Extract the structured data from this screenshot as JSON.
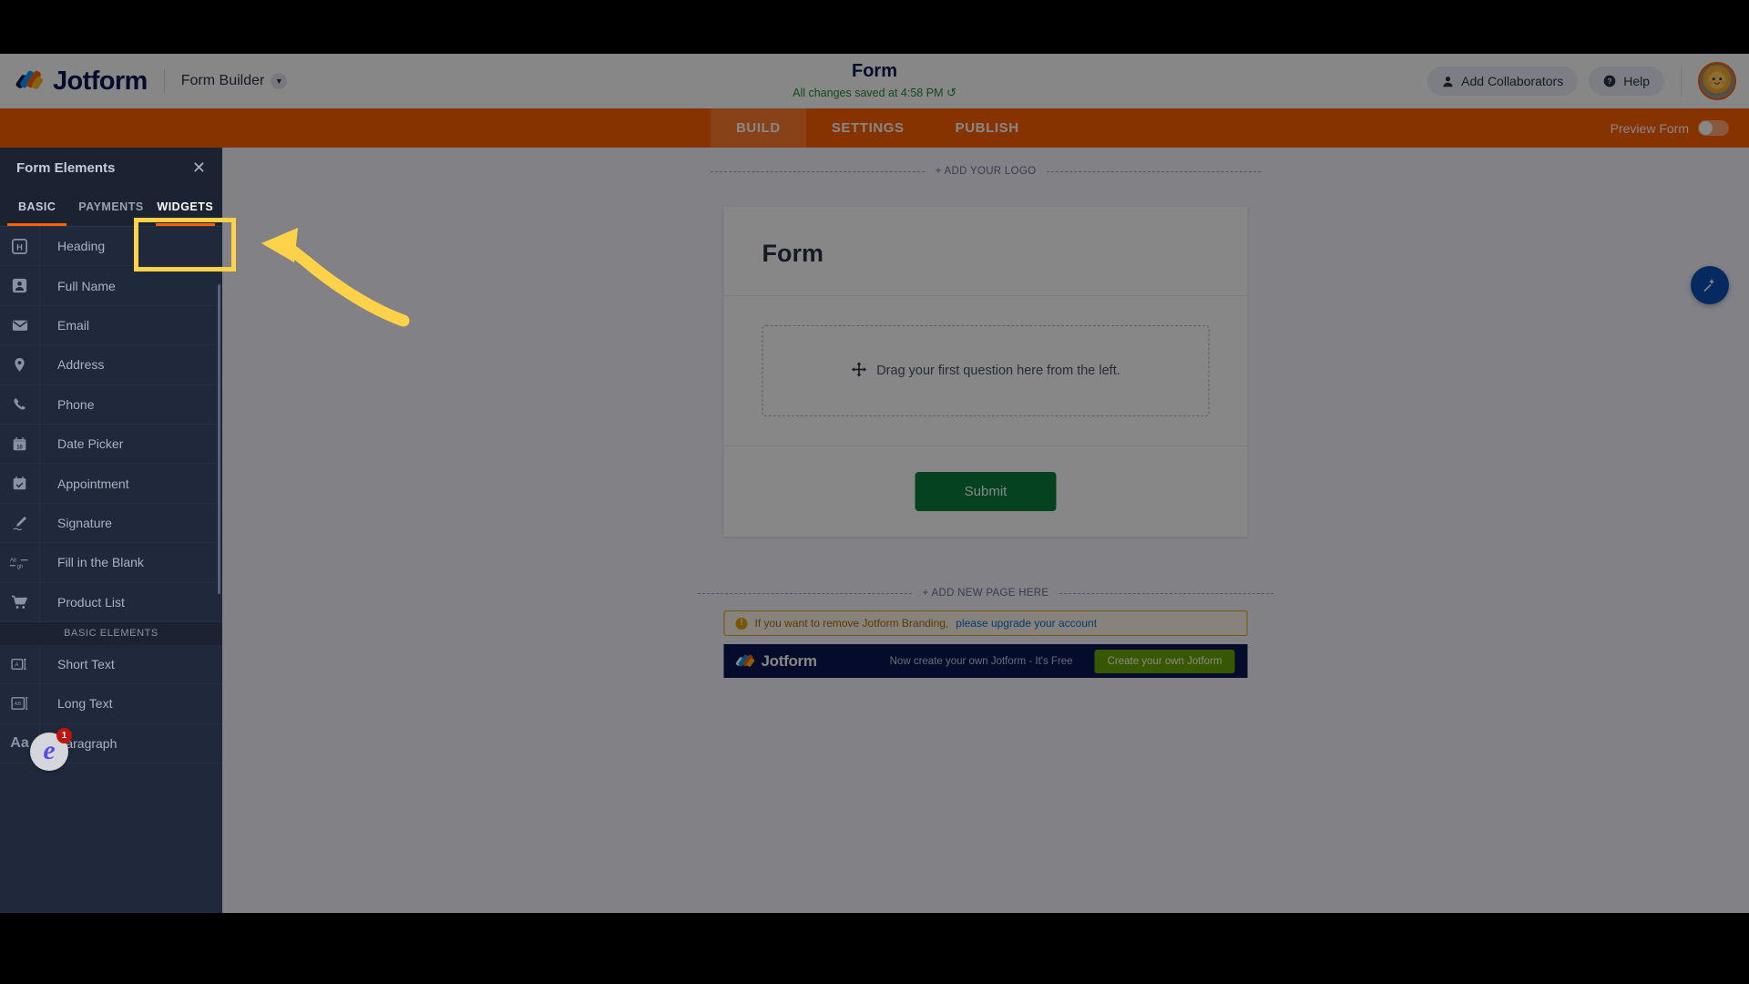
{
  "header": {
    "brand_name": "Jotform",
    "product_menu": "Form Builder",
    "form_title": "Form",
    "save_status": "All changes saved at 4:58 PM",
    "undo_icon": "↺",
    "add_collaborators": "Add Collaborators",
    "help": "Help",
    "collaborator_icon": "person-icon",
    "help_icon": "question-circle-icon",
    "avatar_icon": "user-avatar"
  },
  "navbar": {
    "tabs": [
      {
        "label": "BUILD",
        "active": true
      },
      {
        "label": "SETTINGS",
        "active": false
      },
      {
        "label": "PUBLISH",
        "active": false
      }
    ],
    "preview_label": "Preview Form",
    "preview_on": false
  },
  "sidebar": {
    "title": "Form Elements",
    "close_icon": "close-icon",
    "tabs": [
      {
        "label": "BASIC",
        "active": true
      },
      {
        "label": "PAYMENTS",
        "active": false
      },
      {
        "label": "WIDGETS",
        "active": false,
        "highlighted": true
      }
    ],
    "items": [
      {
        "label": "Heading",
        "icon": "heading-icon"
      },
      {
        "label": "Full Name",
        "icon": "person-card-icon"
      },
      {
        "label": "Email",
        "icon": "envelope-icon"
      },
      {
        "label": "Address",
        "icon": "location-pin-icon"
      },
      {
        "label": "Phone",
        "icon": "phone-icon"
      },
      {
        "label": "Date Picker",
        "icon": "calendar-10-icon"
      },
      {
        "label": "Appointment",
        "icon": "calendar-check-icon"
      },
      {
        "label": "Signature",
        "icon": "pen-signature-icon"
      },
      {
        "label": "Fill in the Blank",
        "icon": "ab-gh-icon"
      },
      {
        "label": "Product List",
        "icon": "shopping-cart-icon"
      }
    ],
    "section_label": "BASIC ELEMENTS",
    "basic_items": [
      {
        "label": "Short Text",
        "icon": "short-text-icon"
      },
      {
        "label": "Long Text",
        "icon": "long-text-icon"
      },
      {
        "label": "Paragraph",
        "icon": "aa-text-icon"
      }
    ]
  },
  "canvas": {
    "add_logo_label": "+ ADD YOUR LOGO",
    "form_heading": "Form",
    "dropzone_text": "Drag your first question here from the left.",
    "dropzone_icon": "move-arrows-icon",
    "submit_label": "Submit",
    "add_page_label": "+ ADD NEW PAGE HERE",
    "notice_text": "If you want to remove Jotform Branding,",
    "notice_link": "please upgrade your account",
    "notice_icon": "warning-icon",
    "banner_brand": "Jotform",
    "banner_text": "Now create your own Jotform - It's Free",
    "banner_button": "Create your own Jotform"
  },
  "widgets": {
    "float_button_icon": "magic-wand-icon",
    "chat_badge_count": "1",
    "chat_icon": "e-chat-icon"
  },
  "annotation": {
    "highlight_target": "WIDGETS",
    "arrow_color": "#ffd24a",
    "box_color": "#ffd24a"
  },
  "colors": {
    "brand_orange": "#ff6100",
    "brand_navy": "#0a1551",
    "sidebar_bg": "#20293b",
    "submit_green": "#0a7d3e",
    "save_green": "#2b8a3e"
  }
}
